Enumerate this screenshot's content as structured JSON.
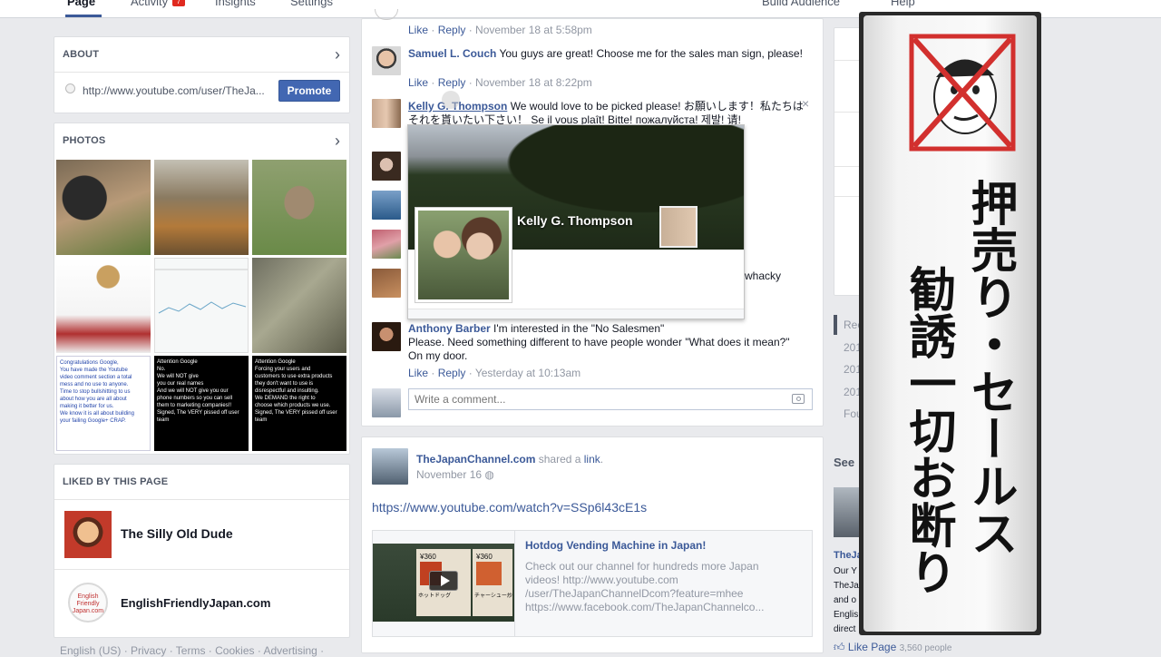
{
  "nav": {
    "tabs": [
      "Page",
      "Activity",
      "Insights",
      "Settings"
    ],
    "activity_badge": "7",
    "right": [
      "Build Audience",
      "Help"
    ]
  },
  "about": {
    "title": "ABOUT",
    "url": "http://www.youtube.com/user/TheJa...",
    "promote": "Promote"
  },
  "photos": {
    "title": "PHOTOS",
    "tile7": [
      "Congratulations Google,",
      "You have made the Youtube",
      "video comment section a total",
      "mess and no use to anyone.",
      "Time to stop bullshitting to us",
      "about how you are all about",
      "making it better for us.",
      "We know it is all about building",
      "your failing Google+ CRAP."
    ],
    "tile8": [
      "Attention Google",
      "No.",
      "We will NOT give",
      "you our real names",
      "And we will NOT give you our",
      "phone numbers so you can sell",
      "them to marketing companies!!",
      "Signed, The VERY pissed off user team"
    ],
    "tile9": [
      "Attention Google",
      "Forcing your users and",
      "customers to use extra products",
      "they don't want to use is",
      "disrespectful and insulting.",
      "We DEMAND the right to",
      "choose which products we use.",
      "Signed, The VERY pissed off user team"
    ]
  },
  "liked": {
    "title": "LIKED BY THIS PAGE",
    "items": [
      "The Silly Old Dude",
      "EnglishFriendlyJapan.com"
    ],
    "logo_text": [
      "English",
      "Friendly",
      "Japan.com"
    ]
  },
  "footer": "English (US) · Privacy · Terms · Cookies · Advertising ·",
  "comments": {
    "c0": {
      "like": "Like",
      "reply": "Reply",
      "time": "November 18 at 5:58pm"
    },
    "c1": {
      "name": "Samuel L. Couch",
      "text": "You guys are great! Choose me for the sales man sign, please!",
      "like": "Like",
      "reply": "Reply",
      "time": "November 18 at 8:22pm"
    },
    "c2": {
      "name": "Kelly G. Thompson",
      "text1": "We would love to be picked please! お願いします！私たちは",
      "text2": "それを貰いたい下さい！ Se il vous plaît! Bitte! пожалуйста! 제발! 请!"
    },
    "partial": "whacky",
    "c3": {
      "name": "Anthony Barber",
      "text1": "I'm interested in the \"No Salesmen\"",
      "text2": "Please. Need something different to have people wonder \"What does it mean?\"",
      "text3": "On my door.",
      "like": "Like",
      "reply": "Reply",
      "time": "Yesterday at 10:13am"
    },
    "placeholder": "Write a comment..."
  },
  "hover": {
    "name": "Kelly G. Thompson"
  },
  "post": {
    "author": "TheJapanChannel.com",
    "shared": "shared a",
    "link": "link",
    "date": "November 16",
    "url": "https://www.youtube.com/watch?v=SSp6l43cE1s",
    "preview": {
      "title": "Hotdog Vending Machine in Japan!",
      "desc": "Check out our channel for hundreds more Japan videos! http://www.youtube.com /user/TheJapanChannelDcom?feature=mhee https://www.facebook.com/TheJapanChannelco...",
      "thumb": {
        "price1": "¥360",
        "price2": "¥360",
        "label1": "ホットドッグ",
        "label2": "チャーシュー炒"
      }
    }
  },
  "right": {
    "items": [
      "Rec",
      "201",
      "201",
      "201",
      "Fou"
    ],
    "see": "See",
    "page": "TheJa",
    "lines": [
      "Our Y",
      "TheJa",
      "and o",
      "Englis",
      "direct"
    ],
    "likepage": "Like Page",
    "people": "3,560 people"
  },
  "sign": {
    "lines": [
      "押売り・セールス",
      "勧誘一切お断り"
    ]
  },
  "colors": {
    "fb_blue": "#3b5998",
    "promote": "#4267b2",
    "sign_red": "#d2302e",
    "bg": "#e9eaed"
  }
}
